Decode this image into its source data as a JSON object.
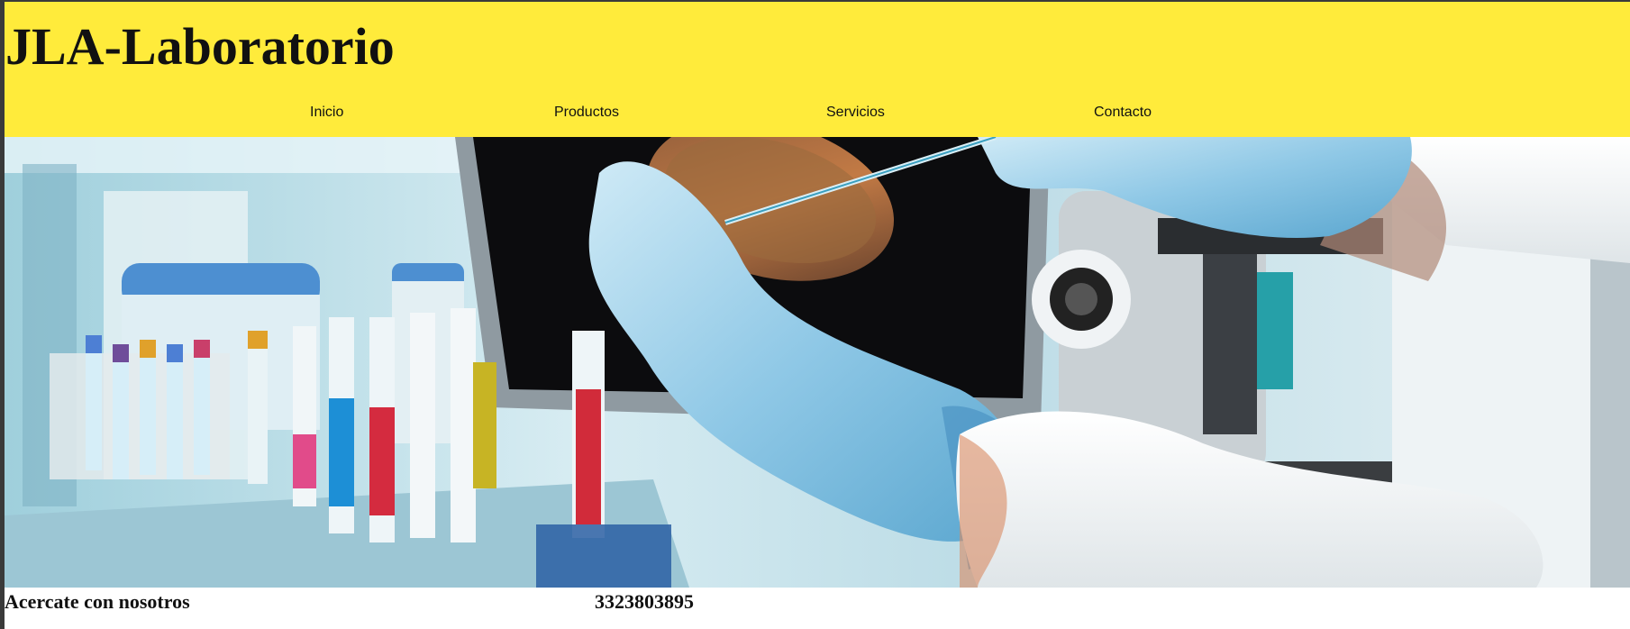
{
  "site": {
    "title": "JLA-Laboratorio"
  },
  "nav": {
    "items": [
      {
        "label": "Inicio"
      },
      {
        "label": "Productos"
      },
      {
        "label": "Servicios"
      },
      {
        "label": "Contacto"
      }
    ]
  },
  "contact": {
    "tagline": "Acercate con nosotros",
    "phone": "3323803895"
  },
  "colors": {
    "header_background": "#ffeb3b",
    "text": "#111111",
    "page_frame": "#3a3a3a"
  }
}
